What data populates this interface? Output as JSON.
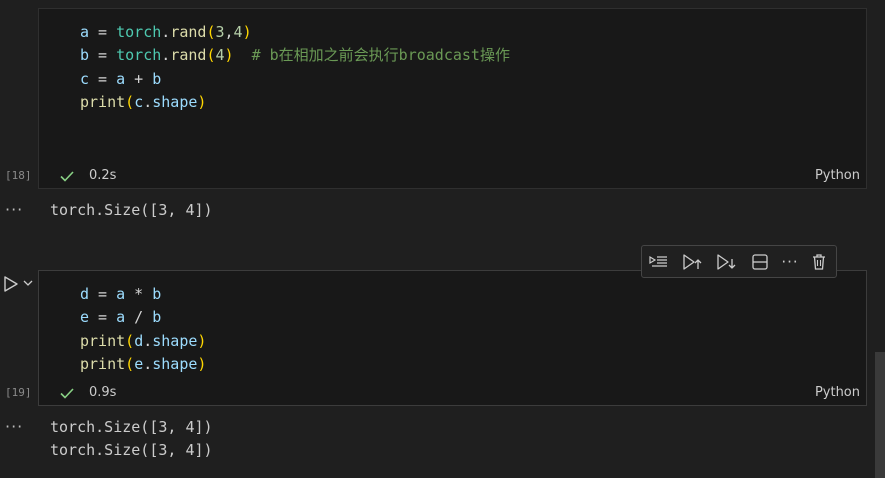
{
  "cells": [
    {
      "exec_count": "[18]",
      "time": "0.2s",
      "language": "Python",
      "code": [
        [
          [
            "v",
            "a"
          ],
          [
            "o",
            " = "
          ],
          [
            "m",
            "torch"
          ],
          [
            "o",
            "."
          ],
          [
            "f",
            "rand"
          ],
          [
            "p",
            "("
          ],
          [
            "n",
            "3"
          ],
          [
            "o",
            ","
          ],
          [
            "n",
            "4"
          ],
          [
            "p",
            ")"
          ]
        ],
        [
          [
            "v",
            "b"
          ],
          [
            "o",
            " = "
          ],
          [
            "m",
            "torch"
          ],
          [
            "o",
            "."
          ],
          [
            "f",
            "rand"
          ],
          [
            "p",
            "("
          ],
          [
            "n",
            "4"
          ],
          [
            "p",
            ")"
          ],
          [
            "o",
            "  "
          ],
          [
            "c",
            "# b在相加之前会执行broadcast操作"
          ]
        ],
        [
          [
            "v",
            "c"
          ],
          [
            "o",
            " = "
          ],
          [
            "v",
            "a"
          ],
          [
            "o",
            " + "
          ],
          [
            "v",
            "b"
          ]
        ],
        [
          [
            "f",
            "print"
          ],
          [
            "p",
            "("
          ],
          [
            "v",
            "c"
          ],
          [
            "o",
            "."
          ],
          [
            "v",
            "shape"
          ],
          [
            "p",
            ")"
          ]
        ]
      ],
      "output": [
        "torch.Size([3, 4])"
      ]
    },
    {
      "exec_count": "[19]",
      "time": "0.9s",
      "language": "Python",
      "code": [
        [
          [
            "v",
            "d"
          ],
          [
            "o",
            " = "
          ],
          [
            "v",
            "a"
          ],
          [
            "o",
            " * "
          ],
          [
            "v",
            "b"
          ]
        ],
        [
          [
            "v",
            "e"
          ],
          [
            "o",
            " = "
          ],
          [
            "v",
            "a"
          ],
          [
            "o",
            " / "
          ],
          [
            "v",
            "b"
          ]
        ],
        [
          [
            "f",
            "print"
          ],
          [
            "p",
            "("
          ],
          [
            "v",
            "d"
          ],
          [
            "o",
            "."
          ],
          [
            "v",
            "shape"
          ],
          [
            "p",
            ")"
          ]
        ],
        [
          [
            "f",
            "print"
          ],
          [
            "p",
            "("
          ],
          [
            "v",
            "e"
          ],
          [
            "o",
            "."
          ],
          [
            "v",
            "shape"
          ],
          [
            "p",
            ")"
          ]
        ]
      ],
      "output": [
        "torch.Size([3, 4])",
        "torch.Size([3, 4])"
      ]
    }
  ],
  "output_ellipsis": "···",
  "toolbar": {
    "buttons": [
      "run-by-line",
      "execute-above",
      "execute-below",
      "split-cell",
      "more-actions",
      "delete-cell"
    ],
    "more_label": "···"
  },
  "colors": {
    "check": "#89d185",
    "comment": "#6a9955",
    "function": "#dcdcaa",
    "variable": "#9cdcfe",
    "module": "#4ec9b0",
    "number": "#b5cea8",
    "bracket": "#ffd700"
  }
}
